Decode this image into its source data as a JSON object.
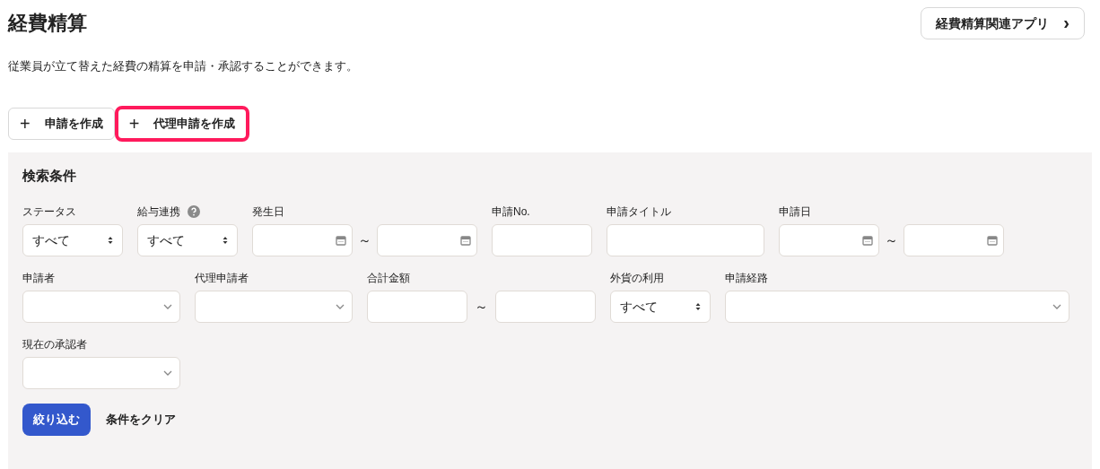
{
  "page": {
    "title": "経費精算",
    "description": "従業員が立て替えた経費の精算を申請・承認することができます。"
  },
  "header_button": {
    "label": "経費精算関連アプリ",
    "icon": "›"
  },
  "actions": [
    {
      "icon": "+",
      "label": "申請を作成",
      "highlighted": false
    },
    {
      "icon": "+",
      "label": "代理申請を作成",
      "highlighted": true
    }
  ],
  "search": {
    "title": "検索条件",
    "fields": [
      {
        "kind": "select",
        "label": "ステータス",
        "value": "すべて"
      },
      {
        "kind": "select",
        "label": "給与連携",
        "value": "すべて",
        "help": true
      },
      {
        "kind": "date_range",
        "label": "発生日",
        "separator": "～"
      },
      {
        "kind": "text",
        "label": "申請No."
      },
      {
        "kind": "text",
        "label": "申請タイトル"
      },
      {
        "kind": "date_range",
        "label": "申請日",
        "separator": "～"
      },
      {
        "kind": "combo",
        "label": "申請者"
      },
      {
        "kind": "combo",
        "label": "代理申請者"
      },
      {
        "kind": "text_range",
        "label": "合計金額",
        "separator": "～"
      },
      {
        "kind": "select",
        "label": "外貨の利用",
        "value": "すべて"
      },
      {
        "kind": "combo",
        "label": "申請経路"
      },
      {
        "kind": "combo",
        "label": "現在の承認者"
      }
    ],
    "buttons": [
      {
        "kind": "primary",
        "label": "絞り込む"
      },
      {
        "kind": "link",
        "label": "条件をクリア"
      }
    ]
  }
}
